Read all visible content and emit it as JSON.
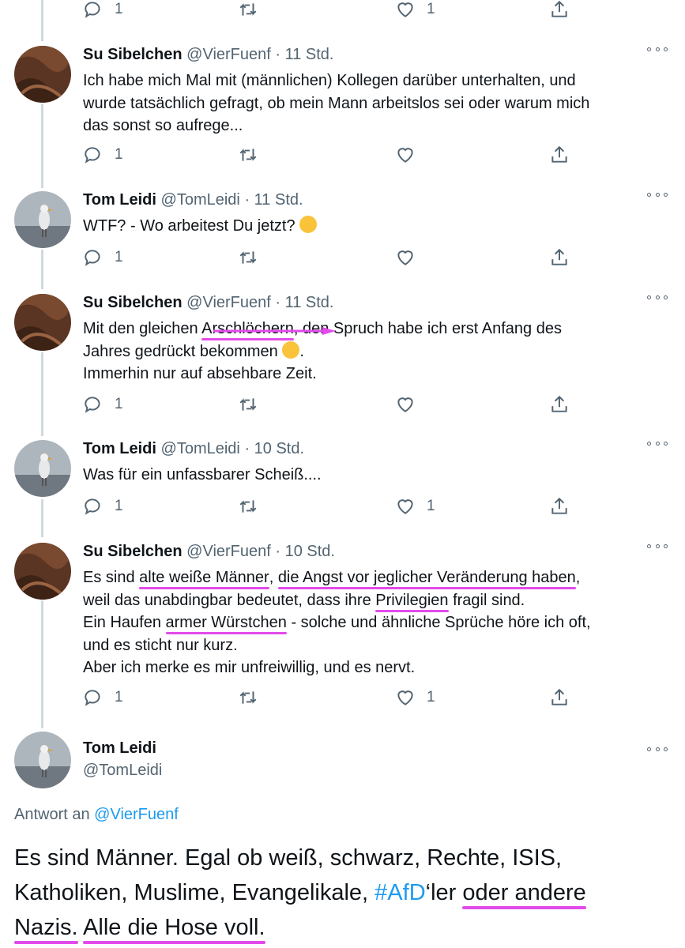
{
  "colors": {
    "accent": "#1d9bf0",
    "highlight": "#e24bea",
    "muted": "#536471"
  },
  "top_actions": {
    "reply_count": "1",
    "like_count": "1"
  },
  "tweets": [
    {
      "name": "Su Sibelchen",
      "handle": "@VierFuenf",
      "time": "· 11 Std.",
      "lines": [
        "Ich habe mich Mal mit (männlichen) Kollegen darüber unterhalten, und",
        "wurde tatsächlich gefragt, ob mein Mann arbeitslos sei oder warum mich",
        "das sonst so aufrege..."
      ],
      "reply_count": "1",
      "like_count": ""
    },
    {
      "name": "Tom Leidi",
      "handle": "@TomLeidi",
      "time": "· 11 Std.",
      "lines": [
        "WTF? - Wo arbeitest Du jetzt?"
      ],
      "reply_count": "1",
      "like_count": ""
    },
    {
      "name": "Su Sibelchen",
      "handle": "@VierFuenf",
      "time": "· 11 Std.",
      "line1_a": "Mit den gleichen ",
      "line1_hl": "Arschlöchern",
      "line1_b": ", den Spruch habe ich erst Anfang des",
      "line2": "Jahres gedrückt bekommen",
      "line2_end": ".",
      "line3": "Immerhin nur auf absehbare Zeit.",
      "reply_count": "1",
      "like_count": ""
    },
    {
      "name": "Tom Leidi",
      "handle": "@TomLeidi",
      "time": "· 10 Std.",
      "lines": [
        "Was für ein unfassbarer Scheiß...."
      ],
      "reply_count": "1",
      "like_count": "1"
    },
    {
      "name": "Su Sibelchen",
      "handle": "@VierFuenf",
      "time": "· 10 Std.",
      "l1_a": "Es sind ",
      "l1_hl1": "alte weiße Männer",
      "l1_b": ", ",
      "l1_hl2": "die Angst vor jeglicher Veränderung haben",
      "l1_c": ",",
      "l2_a": "weil das unabdingbar bedeutet, dass ihre ",
      "l2_hl": "Privilegien",
      "l2_b": " fragil sind.",
      "l3_a": "Ein Haufen ",
      "l3_hl": "armer Würstchen",
      "l3_b": " - solche und ähnliche Sprüche höre ich oft,",
      "l4": "und es sticht nur kurz.",
      "l5": "Aber ich merke es mir unfreiwillig, und es nervt.",
      "reply_count": "1",
      "like_count": "1"
    }
  ],
  "main_tweet": {
    "name": "Tom Leidi",
    "handle": "@TomLeidi",
    "reply_prefix": "Antwort an",
    "reply_handle": "@VierFuenf",
    "l1": "Es sind Männer. Egal ob weiß, schwarz, Rechte, ISIS,",
    "l2_a": "Katholiken, Muslime, Evangelikale, ",
    "l2_tag": "#AfD",
    "l2_b": "‘ler ",
    "l2_hl": "oder andere",
    "l3_hl1": "Nazis.",
    "l3_sp": " ",
    "l3_hl2": "Alle die Hose voll."
  }
}
